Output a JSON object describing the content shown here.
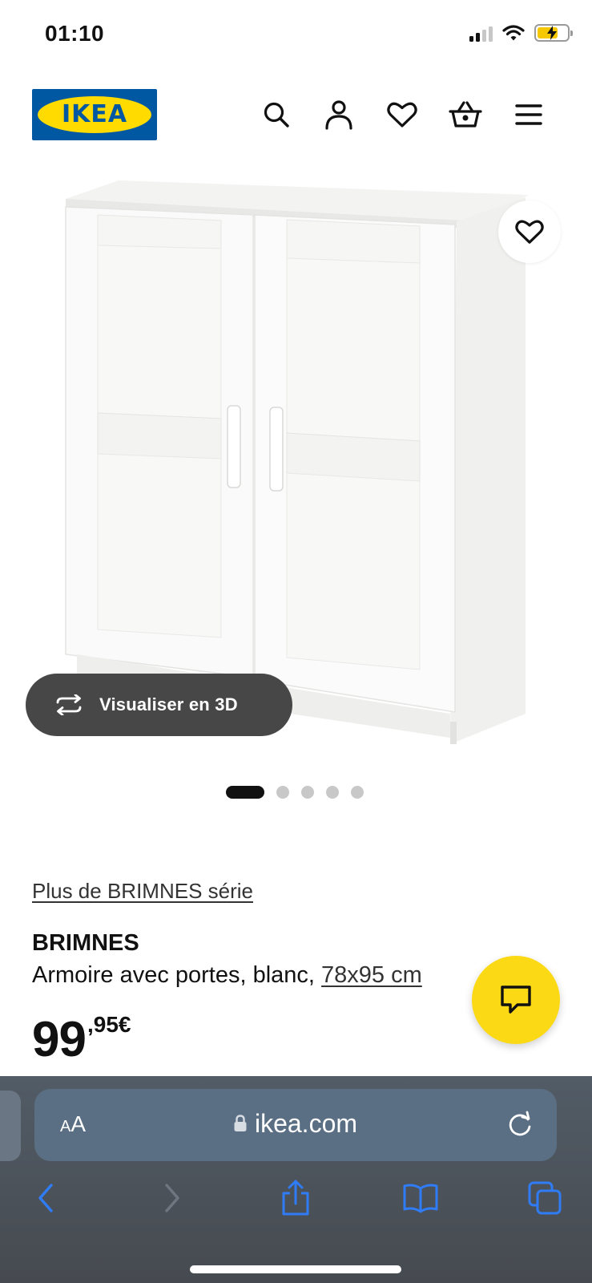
{
  "status_bar": {
    "time": "01:10",
    "icons": [
      "signal-icon",
      "wifi-icon",
      "battery-charging-icon"
    ]
  },
  "header": {
    "logo_text": "IKEA",
    "icons": [
      "search-icon",
      "user-icon",
      "heart-icon",
      "basket-icon",
      "menu-icon"
    ],
    "colors": {
      "logo_blue": "#0058a3",
      "logo_yellow": "#ffdb00"
    }
  },
  "product_image": {
    "favorite_icon": "heart-icon",
    "view_3d_label": "Visualiser en 3D",
    "view_3d_icon": "rotate-3d-icon"
  },
  "carousel": {
    "total": 5,
    "active_index": 0
  },
  "product": {
    "series_link": "Plus de BRIMNES série",
    "name": "BRIMNES",
    "description": "Armoire avec portes, blanc,",
    "dimensions": "78x95 cm",
    "price_int": "99",
    "price_dec": ",95€"
  },
  "chat": {
    "icon": "chat-bubble-icon",
    "color": "#fbd914"
  },
  "browser": {
    "aa_label_small": "A",
    "aa_label_large": "A",
    "domain": "ikea.com",
    "icons": [
      "lock-icon",
      "reload-icon",
      "back-icon",
      "forward-icon",
      "share-icon",
      "bookmarks-icon",
      "tabs-icon"
    ],
    "accent": "#2f7cf6"
  }
}
